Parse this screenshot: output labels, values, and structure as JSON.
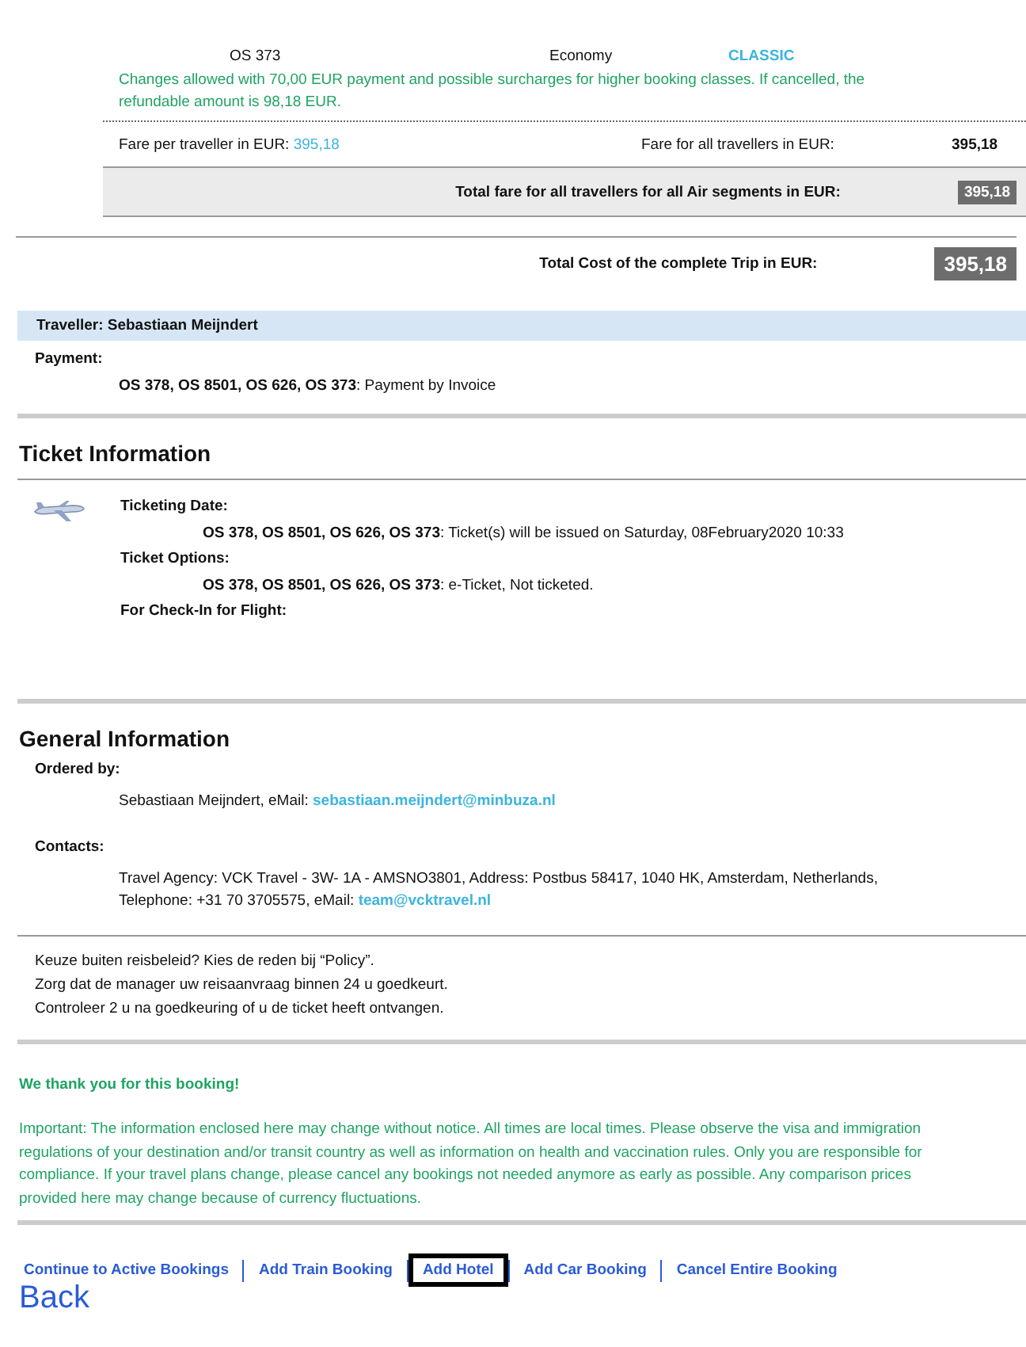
{
  "flights": [
    {
      "flight": "OS 373",
      "cabin": "Economy",
      "fare_class": "CLASSIC"
    }
  ],
  "fare_note": "Changes allowed with 70,00 EUR payment and possible surcharges for higher booking classes. If cancelled, the refundable amount is 98,18 EUR.",
  "fare_per_traveller": {
    "label": "Fare per traveller in EUR:",
    "value": "395,18"
  },
  "fare_all_travellers": {
    "label": "Fare for all travellers in EUR:",
    "value": "395,18"
  },
  "air_total": {
    "label": "Total fare for all travellers for all Air segments in EUR:",
    "value": "395,18"
  },
  "trip_total": {
    "label": "Total Cost of the complete Trip in EUR:",
    "value": "395,18"
  },
  "traveller": "Traveller: Sebastiaan Meijndert",
  "payment": {
    "label": "Payment:",
    "lines": [
      "**OS 378, OS 8501, OS 626, OS 373**: Payment by Invoice"
    ]
  },
  "ticket_information": {
    "heading": "Ticket Information",
    "items": [
      {
        "label": "Ticketing Date:",
        "lines": [
          "**OS 378, OS 8501, OS 626, OS 373**: Ticket(s) will be issued on Saturday, 08February2020 10:33"
        ]
      },
      {
        "label": "Ticket Options:",
        "lines": [
          "**OS 378, OS 8501, OS 626, OS 373**: e-Ticket, Not ticketed."
        ]
      },
      {
        "label": "For Check-In for Flight:"
      }
    ]
  },
  "general_information": {
    "heading": "General Information",
    "ordered_by": {
      "label": "Ordered by:",
      "text": "Sebastiaan Meijndert, eMail:",
      "email": "sebastiaan.meijndert@minbuza.nl"
    },
    "contacts": {
      "label": "Contacts:",
      "text": "Travel Agency: VCK Travel - 3W- 1A - AMSNO3801, Address: Postbus 58417, 1040 HK, Amsterdam, Netherlands, Telephone: +31 70 3705575, eMail:",
      "email": "team@vcktravel.nl"
    }
  },
  "policy_lines": [
    "Keuze buiten reisbeleid? Kies de reden bij “Policy”.",
    "Zorg dat de manager uw reisaanvraag binnen 24 u goedkeurt.",
    "Controleer 2 u na goedkeuring of u de ticket heeft ontvangen."
  ],
  "thanks": "We thank you for this booking!",
  "important": "Important: The information enclosed here may change without notice. All times are local times. Please observe the visa and immigration regulations of your destination and/or transit country as well as information on health and vaccination rules. Only you are responsible for compliance. If your travel plans change, please cancel any bookings not needed anymore as early as possible. Any comparison prices provided here may change because of currency fluctuations.",
  "actions": [
    {
      "label": "Continue to Active Bookings",
      "highlighted": false
    },
    {
      "label": "Add Train Booking",
      "highlighted": false
    },
    {
      "label": "Add Hotel",
      "highlighted": true
    },
    {
      "label": "Add Car Booking",
      "highlighted": false
    },
    {
      "label": "Cancel Entire Booking",
      "highlighted": false
    }
  ],
  "back": "Back"
}
